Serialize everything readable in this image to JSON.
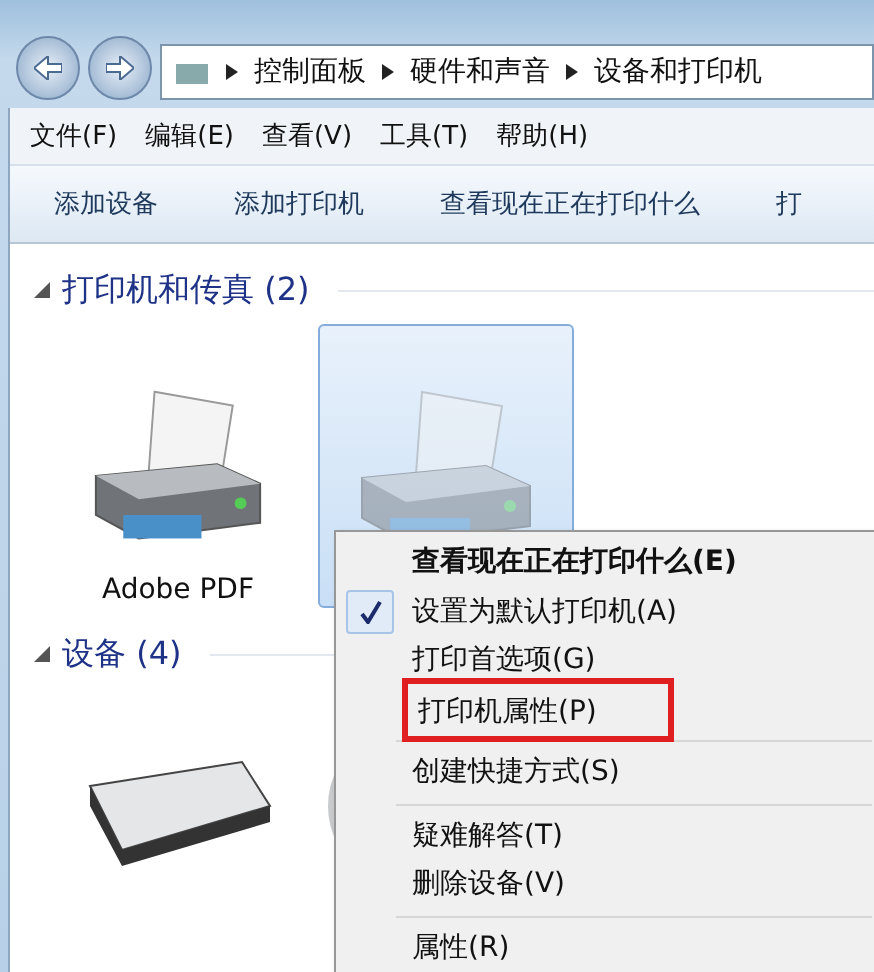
{
  "breadcrumb": [
    "控制面板",
    "硬件和声音",
    "设备和打印机"
  ],
  "menu_bar": [
    "文件(F)",
    "编辑(E)",
    "查看(V)",
    "工具(T)",
    "帮助(H)"
  ],
  "commands": [
    "添加设备",
    "添加打印机",
    "查看现在正在打印什么",
    "打"
  ],
  "groups": [
    {
      "title": "打印机和传真 (2)",
      "expanded": true,
      "items": [
        {
          "kind": "printer",
          "label": "Adobe PDF",
          "selected": false
        },
        {
          "kind": "printer",
          "selected": true
        }
      ]
    },
    {
      "title": "设备 (4)",
      "expanded": true,
      "items": [
        {
          "kind": "keyboard",
          "selected": false
        },
        {
          "kind": "device",
          "selected": false
        }
      ]
    }
  ],
  "context_menu": [
    {
      "kind": "item",
      "label": "查看现在正在打印什么(E)",
      "default": true,
      "checked": false,
      "highlighted": false
    },
    {
      "kind": "item",
      "label": "设置为默认打印机(A)",
      "default": false,
      "checked": true,
      "highlighted": false
    },
    {
      "kind": "item",
      "label": "打印首选项(G)",
      "default": false,
      "checked": false,
      "highlighted": false
    },
    {
      "kind": "item",
      "label": "打印机属性(P)",
      "default": false,
      "checked": false,
      "highlighted": true
    },
    {
      "kind": "separator"
    },
    {
      "kind": "item",
      "label": "创建快捷方式(S)",
      "default": false,
      "checked": false,
      "highlighted": false
    },
    {
      "kind": "separator"
    },
    {
      "kind": "item",
      "label": "疑难解答(T)",
      "default": false,
      "checked": false,
      "highlighted": false
    },
    {
      "kind": "item",
      "label": "删除设备(V)",
      "default": false,
      "checked": false,
      "highlighted": false
    },
    {
      "kind": "separator"
    },
    {
      "kind": "item",
      "label": "属性(R)",
      "default": false,
      "checked": false,
      "highlighted": false
    }
  ]
}
